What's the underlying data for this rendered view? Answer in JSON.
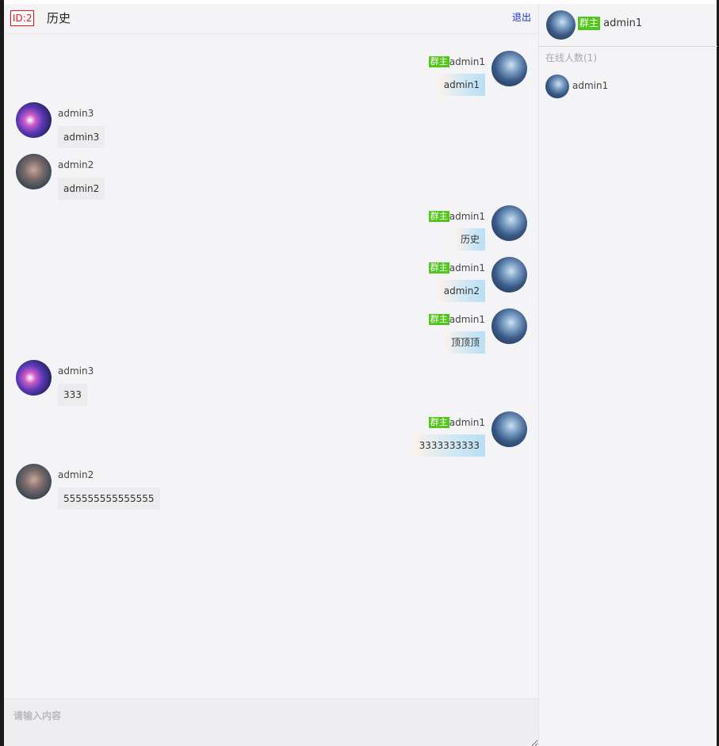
{
  "header": {
    "room_id": "ID:2",
    "title": "历史",
    "logout": "退出"
  },
  "owner_badge": "群主",
  "messages": [
    {
      "side": "right",
      "user": "admin1",
      "owner": true,
      "text": "admin1",
      "avatar": "admin1-avatar"
    },
    {
      "side": "left",
      "user": "admin3",
      "owner": false,
      "text": "admin3",
      "avatar": "admin3-avatar"
    },
    {
      "side": "left",
      "user": "admin2",
      "owner": false,
      "text": "admin2",
      "avatar": "admin2-avatar"
    },
    {
      "side": "right",
      "user": "admin1",
      "owner": true,
      "text": "历史",
      "avatar": "admin1-avatar"
    },
    {
      "side": "right",
      "user": "admin1",
      "owner": true,
      "text": "admin2",
      "avatar": "admin1-avatar"
    },
    {
      "side": "right",
      "user": "admin1",
      "owner": true,
      "text": "顶顶顶",
      "avatar": "admin1-avatar"
    },
    {
      "side": "left",
      "user": "admin3",
      "owner": false,
      "text": "333",
      "avatar": "admin3-avatar"
    },
    {
      "side": "right",
      "user": "admin1",
      "owner": true,
      "text": "3333333333",
      "avatar": "admin1-avatar"
    },
    {
      "side": "left",
      "user": "admin2",
      "owner": false,
      "text": "555555555555555",
      "avatar": "admin2-avatar"
    }
  ],
  "input": {
    "placeholder": "请输入内容",
    "value": ""
  },
  "sidebar": {
    "current_user": "admin1",
    "online_label": "在线人数(1)",
    "online_users": [
      {
        "name": "admin1",
        "avatar": "admin1-avatar"
      }
    ]
  },
  "colors": {
    "owner_badge": "#52c41a",
    "room_id": "#ee1111",
    "logout_link": "#1a2fd4"
  }
}
